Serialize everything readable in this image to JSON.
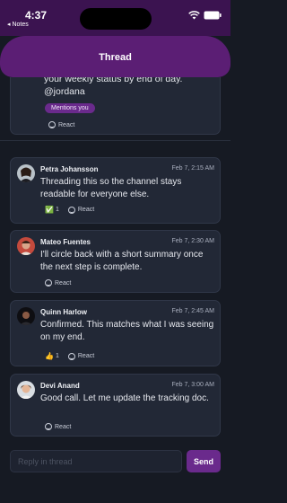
{
  "status": {
    "time": "4:37",
    "back_label": "◂ Notes"
  },
  "header": {
    "title": "Thread"
  },
  "first_message": {
    "text_line1": "your weekly status by end of day.",
    "text_line2": "@jordana",
    "mention_badge": "Mentions you",
    "react_label": "React"
  },
  "messages": [
    {
      "author": "Petra Johansson",
      "time": "Feb 7, 2:15 AM",
      "text": "Threading this so the channel stays readable for everyone else.",
      "reaction": {
        "emoji": "✅",
        "count": "1"
      },
      "react_label": "React"
    },
    {
      "author": "Mateo Fuentes",
      "time": "Feb 7, 2:30 AM",
      "text": "I'll circle back with a short summary once the next step is complete.",
      "react_label": "React"
    },
    {
      "author": "Quinn Harlow",
      "time": "Feb 7, 2:45 AM",
      "text": "Confirmed. This matches what I was seeing on my end.",
      "reaction": {
        "emoji": "👍",
        "count": "1"
      },
      "react_label": "React"
    },
    {
      "author": "Devi Anand",
      "time": "Feb 7, 3:00 AM",
      "text": "Good call. Let me update the tracking doc.",
      "react_label": "React"
    }
  ],
  "composer": {
    "placeholder": "Reply in thread",
    "send_label": "Send"
  },
  "colors": {
    "header": "#5b1e74",
    "accent": "#6a2a8c",
    "background": "#161a23",
    "card": "#222836"
  }
}
